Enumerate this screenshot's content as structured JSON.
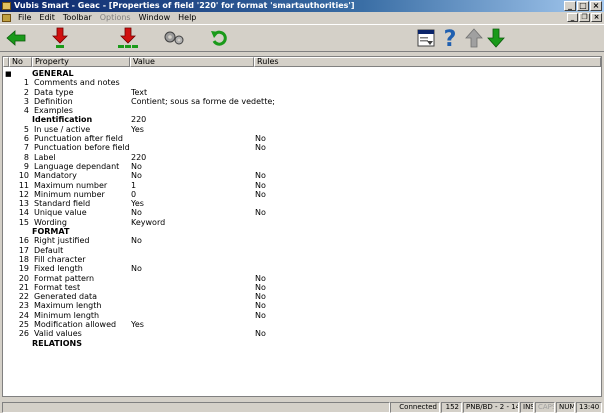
{
  "window": {
    "title": "Vubis Smart - Geac - [Properties of field '220' for format 'smartauthorities']"
  },
  "menu": [
    {
      "label": "File",
      "enabled": true
    },
    {
      "label": "Edit",
      "enabled": true
    },
    {
      "label": "Toolbar",
      "enabled": true
    },
    {
      "label": "Options",
      "enabled": false
    },
    {
      "label": "Window",
      "enabled": true
    },
    {
      "label": "Help",
      "enabled": true
    }
  ],
  "toolbar": {
    "icons": [
      "back-arrow-icon",
      "insert-line-icon",
      "insert-multiple-lines-icon",
      "settings-gears-icon",
      "refresh-icon",
      "window-icon",
      "help-icon",
      "up-arrow-icon",
      "down-arrow-icon"
    ]
  },
  "grid": {
    "columns": {
      "no": "No",
      "property": "Property",
      "value": "Value",
      "rules": "Rules"
    },
    "rows": [
      {
        "no": "",
        "property": "GENERAL",
        "value": "",
        "rules": "",
        "section": true
      },
      {
        "no": "1",
        "property": "Comments and notes",
        "value": "",
        "rules": ""
      },
      {
        "no": "2",
        "property": "Data type",
        "value": "Text",
        "rules": ""
      },
      {
        "no": "3",
        "property": "Definition",
        "value": "Contient; sous sa forme de vedette;",
        "rules": ""
      },
      {
        "no": "4",
        "property": "Examples",
        "value": "",
        "rules": ""
      },
      {
        "no": "",
        "property": "Identification",
        "value": "220",
        "rules": "",
        "section": true
      },
      {
        "no": "5",
        "property": "In use / active",
        "value": "Yes",
        "rules": ""
      },
      {
        "no": "6",
        "property": "Punctuation after field",
        "value": "",
        "rules": "No"
      },
      {
        "no": "7",
        "property": "Punctuation before field",
        "value": "",
        "rules": "No"
      },
      {
        "no": "8",
        "property": "Label",
        "value": "220",
        "rules": ""
      },
      {
        "no": "9",
        "property": "Language dependant",
        "value": "No",
        "rules": ""
      },
      {
        "no": "10",
        "property": "Mandatory",
        "value": "No",
        "rules": "No"
      },
      {
        "no": "11",
        "property": "Maximum number",
        "value": "1",
        "rules": "No"
      },
      {
        "no": "12",
        "property": "Minimum number",
        "value": "0",
        "rules": "No"
      },
      {
        "no": "13",
        "property": "Standard field",
        "value": "Yes",
        "rules": ""
      },
      {
        "no": "14",
        "property": "Unique value",
        "value": "No",
        "rules": "No"
      },
      {
        "no": "15",
        "property": "Wording",
        "value": "Keyword",
        "rules": ""
      },
      {
        "no": "",
        "property": "FORMAT",
        "value": "",
        "rules": "",
        "section": true
      },
      {
        "no": "16",
        "property": "Right justified",
        "value": "No",
        "rules": ""
      },
      {
        "no": "17",
        "property": "Default",
        "value": "",
        "rules": ""
      },
      {
        "no": "18",
        "property": "Fill character",
        "value": "",
        "rules": ""
      },
      {
        "no": "19",
        "property": "Fixed length",
        "value": "No",
        "rules": ""
      },
      {
        "no": "20",
        "property": "Format pattern",
        "value": "",
        "rules": "No"
      },
      {
        "no": "21",
        "property": "Format test",
        "value": "",
        "rules": "No"
      },
      {
        "no": "22",
        "property": "Generated data",
        "value": "",
        "rules": "No"
      },
      {
        "no": "23",
        "property": "Maximum length",
        "value": "",
        "rules": "No"
      },
      {
        "no": "24",
        "property": "Minimum length",
        "value": "",
        "rules": "No"
      },
      {
        "no": "25",
        "property": "Modification allowed",
        "value": "Yes",
        "rules": ""
      },
      {
        "no": "26",
        "property": "Valid values",
        "value": "",
        "rules": "No"
      },
      {
        "no": "",
        "property": "RELATIONS",
        "value": "",
        "rules": "",
        "section": true
      }
    ]
  },
  "status": {
    "connection": "Connected",
    "count": "152",
    "location": "PNB/BD - 2 - 148",
    "ins": "INS",
    "caps": "CAPS",
    "num": "NUM",
    "time": "13:40"
  },
  "colors": {
    "title_start": "#0a246a",
    "title_end": "#a6caf0",
    "arrow_green": "#1a9a1a",
    "arrow_red": "#d01010"
  }
}
